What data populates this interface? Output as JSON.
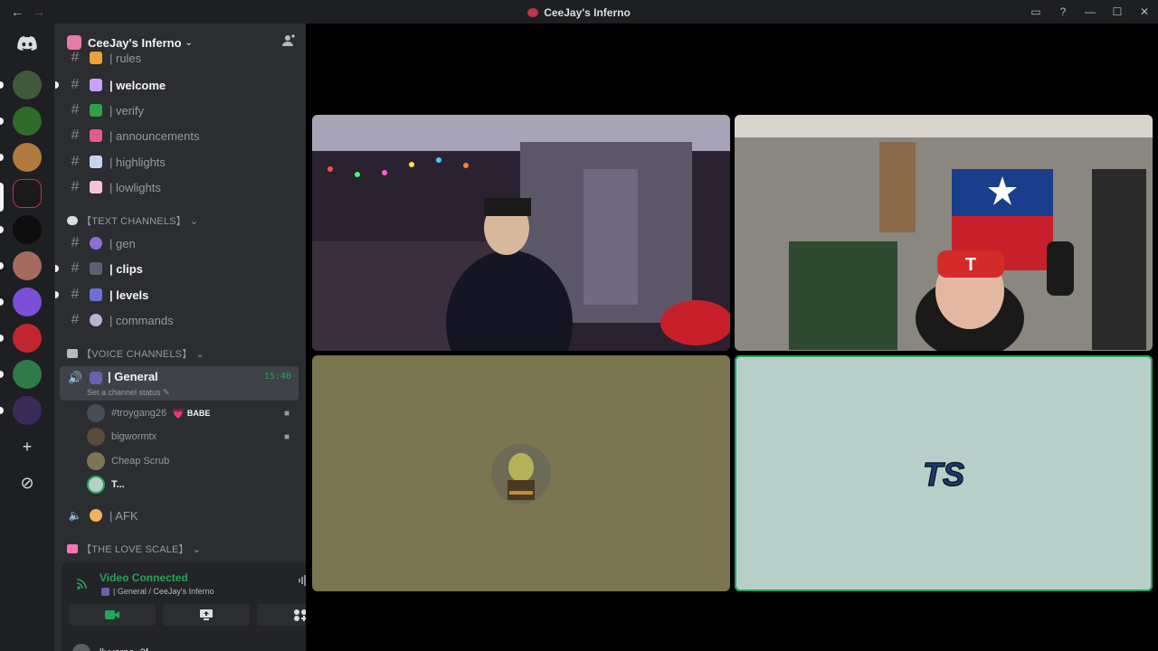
{
  "window": {
    "title": "CeeJay's Inferno",
    "nav_back": "←",
    "nav_forward": "→",
    "controls": [
      "▭",
      "?",
      "—",
      "☐",
      "✕"
    ]
  },
  "server": {
    "name": "CeeJay's Inferno",
    "caret": "⌄",
    "invite_icon": "person-add-icon"
  },
  "channels": [
    {
      "label": "| rules",
      "unread": false,
      "emoji_color": "#e8a33c"
    },
    {
      "label": "| welcome",
      "unread": true,
      "emoji_color": "#c9a0ff"
    },
    {
      "label": "| verify",
      "unread": false,
      "emoji_color": "#2ea043"
    },
    {
      "label": "| announcements",
      "unread": false,
      "emoji_color": "#e25a8f"
    },
    {
      "label": "| highlights",
      "unread": false,
      "emoji_color": "#c6d3f0"
    },
    {
      "label": "| lowlights",
      "unread": false,
      "emoji_color": "#f5c2d6"
    }
  ],
  "categories": {
    "text": "【TEXT CHANNELS】",
    "voice": "【VOICE CHANNELS】",
    "love": "【THE LOVE SCALE】",
    "caret": "⌄"
  },
  "text_channels": [
    {
      "label": "| gen",
      "unread": false,
      "emoji_color": "#8e6fd6"
    },
    {
      "label": "| clips",
      "unread": true,
      "emoji_color": "#5b5f72"
    },
    {
      "label": "| levels",
      "unread": true,
      "emoji_color": "#6d6fd9"
    },
    {
      "label": "| commands",
      "unread": false,
      "emoji_color": "#b7b0d9"
    }
  ],
  "voice": {
    "name": "| General",
    "time": "15:40",
    "status": "Set a channel status ✎",
    "users": [
      {
        "name": "#troygang26",
        "badge": "BABE",
        "heart": "💗",
        "camera": true,
        "avatar_color": "#4a4c55"
      },
      {
        "name": "bigwormtx",
        "badge": "",
        "camera": true,
        "avatar_color": "#5a4a3a"
      },
      {
        "name": "Cheap Scrub",
        "badge": "",
        "camera": false,
        "avatar_color": "#7b7550"
      },
      {
        "name": "T...",
        "badge": "",
        "camera": false,
        "avatar_color": "#b8cfc9"
      }
    ],
    "afk": "| AFK"
  },
  "panel": {
    "status": "Video Connected",
    "location": "| General / CeeJay's Inferno",
    "signal_icon": "signal-icon",
    "noise_icon": "noise-suppression-icon",
    "hangup_icon": "disconnect-icon",
    "partial_user": "lluverne_2f"
  },
  "stage": {
    "tiles": [
      {
        "name": "webcam-bedroom",
        "bg": "#2a2230"
      },
      {
        "name": "webcam-flag-room",
        "bg": "#8a8680"
      },
      {
        "name": "avatar-tile-olive",
        "bg": "#7b7550"
      },
      {
        "name": "avatar-tile-mint",
        "bg": "#b8cfc9"
      }
    ]
  },
  "colors": {
    "accent_green": "#23a55a",
    "sidebar": "#2b2d31",
    "guildbar": "#1e1f22"
  }
}
